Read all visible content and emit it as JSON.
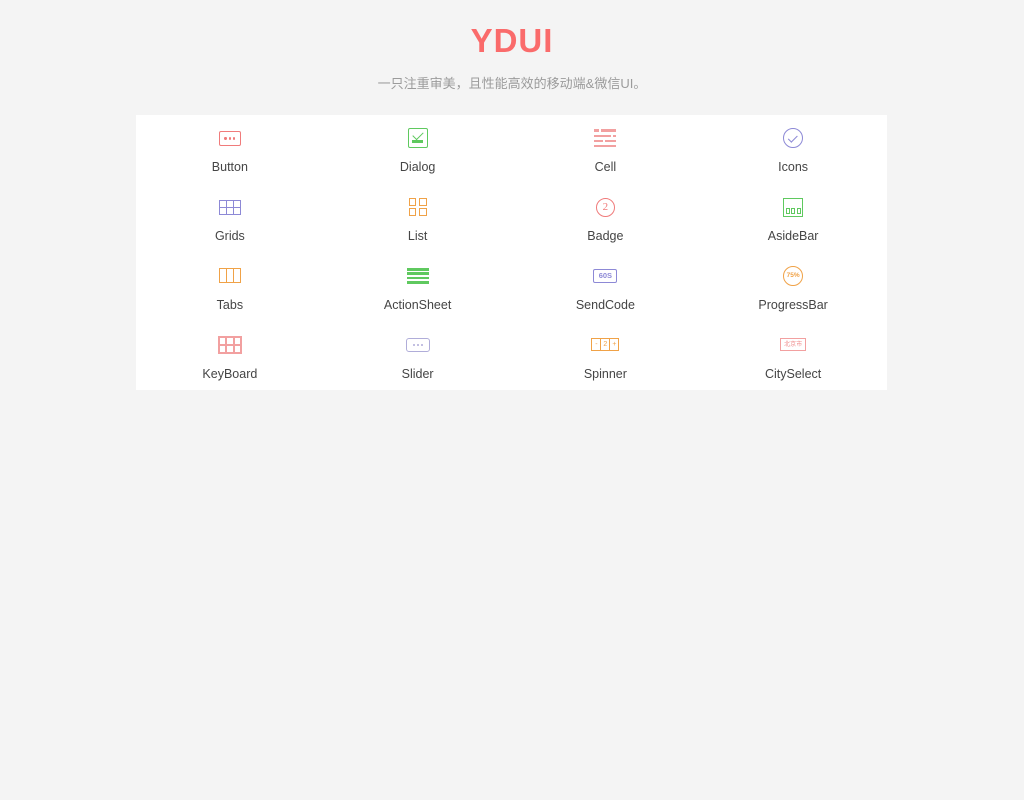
{
  "header": {
    "title": "YDUI",
    "subtitle": "一只注重审美，且性能高效的移动端&微信UI。",
    "title_color": "#fa6b6b",
    "subtitle_color": "#9b9b9b"
  },
  "page": {
    "background_color": "#f4f4f4",
    "card_background_color": "#ffffff"
  },
  "nav": {
    "items": [
      {
        "label": "Button",
        "icon": "button-icon",
        "color": "#f07b7b"
      },
      {
        "label": "Dialog",
        "icon": "dialog-icon",
        "color": "#5fc95f"
      },
      {
        "label": "Cell",
        "icon": "cell-icon",
        "color": "#f2a0a0"
      },
      {
        "label": "Icons",
        "icon": "icons-icon",
        "color": "#8d89d6"
      },
      {
        "label": "Grids",
        "icon": "grids-icon",
        "color": "#8d89d6"
      },
      {
        "label": "List",
        "icon": "list-icon",
        "color": "#f0a247"
      },
      {
        "label": "Badge",
        "icon": "badge-icon",
        "color": "#f07b7b",
        "icon_text": "2"
      },
      {
        "label": "AsideBar",
        "icon": "asidebar-icon",
        "color": "#5fc95f"
      },
      {
        "label": "Tabs",
        "icon": "tabs-icon",
        "color": "#f0a247"
      },
      {
        "label": "ActionSheet",
        "icon": "actionsheet-icon",
        "color": "#5fc95f"
      },
      {
        "label": "SendCode",
        "icon": "sendcode-icon",
        "color": "#8d89d6",
        "icon_text": "60S"
      },
      {
        "label": "ProgressBar",
        "icon": "progressbar-icon",
        "color": "#f0a247",
        "icon_text": "75%"
      },
      {
        "label": "KeyBoard",
        "icon": "keyboard-icon",
        "color": "#f2a0a0"
      },
      {
        "label": "Slider",
        "icon": "slider-icon",
        "color": "#b0add9"
      },
      {
        "label": "Spinner",
        "icon": "spinner-icon",
        "color": "#f0a247",
        "icon_minus": "-",
        "icon_value": "2",
        "icon_plus": "+"
      },
      {
        "label": "CitySelect",
        "icon": "cityselect-icon",
        "color": "#f08c8c",
        "icon_text": "北京市"
      }
    ]
  }
}
